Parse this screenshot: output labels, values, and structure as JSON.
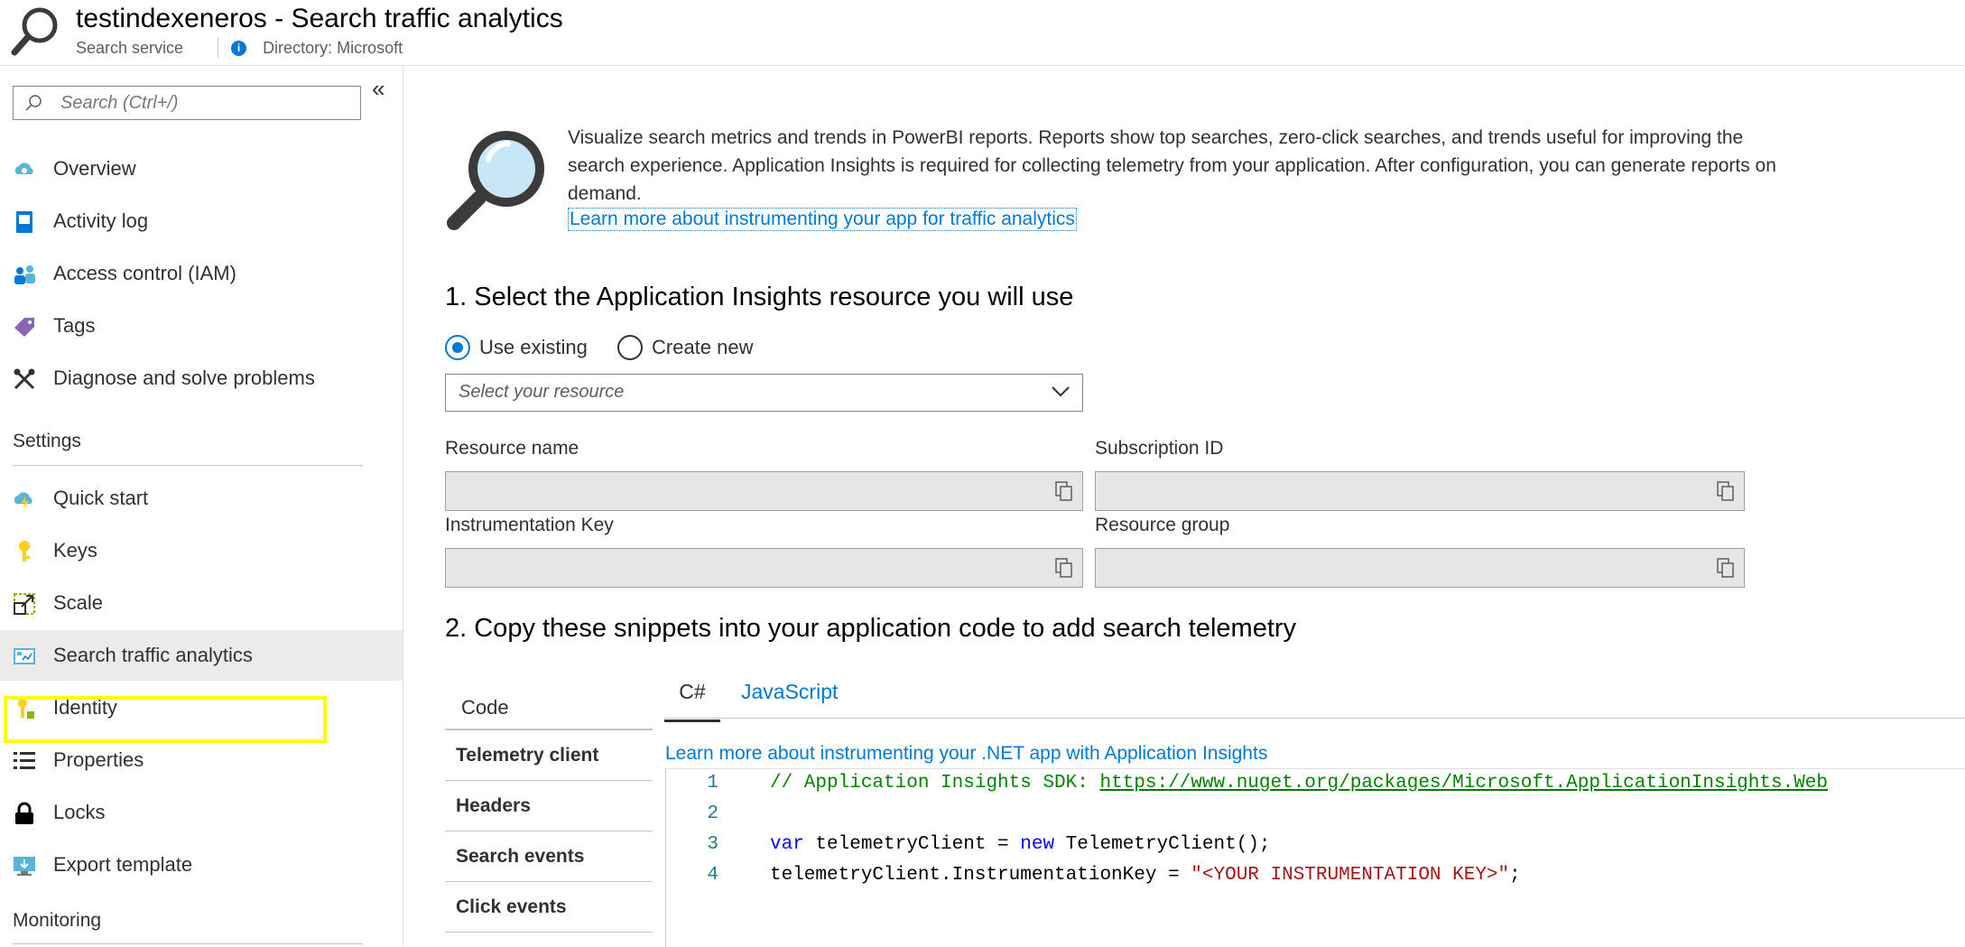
{
  "header": {
    "title": "testindexeneros - Search traffic analytics",
    "subtitle": "Search service",
    "directory": "Directory: Microsoft",
    "info_glyph": "i"
  },
  "sidebar": {
    "search_placeholder": "Search (Ctrl+/)",
    "collapse_glyph": "«",
    "items_top": [
      {
        "label": "Overview",
        "icon": "cloud-overview-icon"
      },
      {
        "label": "Activity log",
        "icon": "activity-log-icon"
      },
      {
        "label": "Access control (IAM)",
        "icon": "people-icon"
      },
      {
        "label": "Tags",
        "icon": "tag-icon"
      },
      {
        "label": "Diagnose and solve problems",
        "icon": "wrench-icon"
      }
    ],
    "settings_header": "Settings",
    "items_settings": [
      {
        "label": "Quick start",
        "icon": "cloud-lightning-icon"
      },
      {
        "label": "Keys",
        "icon": "key-icon"
      },
      {
        "label": "Scale",
        "icon": "scale-icon"
      },
      {
        "label": "Search traffic analytics",
        "icon": "analytics-icon"
      },
      {
        "label": "Identity",
        "icon": "identity-key-icon"
      },
      {
        "label": "Properties",
        "icon": "list-icon"
      },
      {
        "label": "Locks",
        "icon": "lock-icon"
      },
      {
        "label": "Export template",
        "icon": "export-template-icon"
      }
    ],
    "monitoring_header": "Monitoring"
  },
  "main": {
    "intro": "Visualize search metrics and trends in PowerBI reports. Reports show top searches, zero-click searches, and trends useful for improving the search experience. Application Insights is required for collecting telemetry from your application. After configuration, you can generate reports on demand.",
    "learn_link": "Learn more about instrumenting your app for traffic analytics",
    "step1_title": "1. Select the Application Insights resource you will use",
    "radio_existing": "Use existing",
    "radio_new": "Create new",
    "resource_placeholder": "Select your resource",
    "fields": {
      "resource_name": "Resource name",
      "subscription_id": "Subscription ID",
      "instrumentation_key": "Instrumentation Key",
      "resource_group": "Resource group"
    },
    "step2_title": "2. Copy these snippets into your application code to add search telemetry",
    "code_header": "Code",
    "code_items": [
      "Telemetry client",
      "Headers",
      "Search events",
      "Click events"
    ],
    "tabs": [
      "C#",
      "JavaScript"
    ],
    "net_link": "Learn more about instrumenting your .NET app with Application Insights",
    "code": {
      "line_numbers": [
        "1",
        "2",
        "3",
        "4"
      ],
      "l1_comment": "// Application Insights SDK: ",
      "l1_url": "https://www.nuget.org/packages/Microsoft.ApplicationInsights.Web",
      "l3_kw1": "var",
      "l3_mid": " telemetryClient = ",
      "l3_kw2": "new",
      "l3_end": " TelemetryClient();",
      "l4_start": "telemetryClient.InstrumentationKey = ",
      "l4_str": "\"<YOUR INSTRUMENTATION KEY>\"",
      "l4_end": ";"
    }
  },
  "colors": {
    "accent": "#0078d4",
    "highlight": "#ffff00",
    "field_bg": "#e6e6e6"
  }
}
